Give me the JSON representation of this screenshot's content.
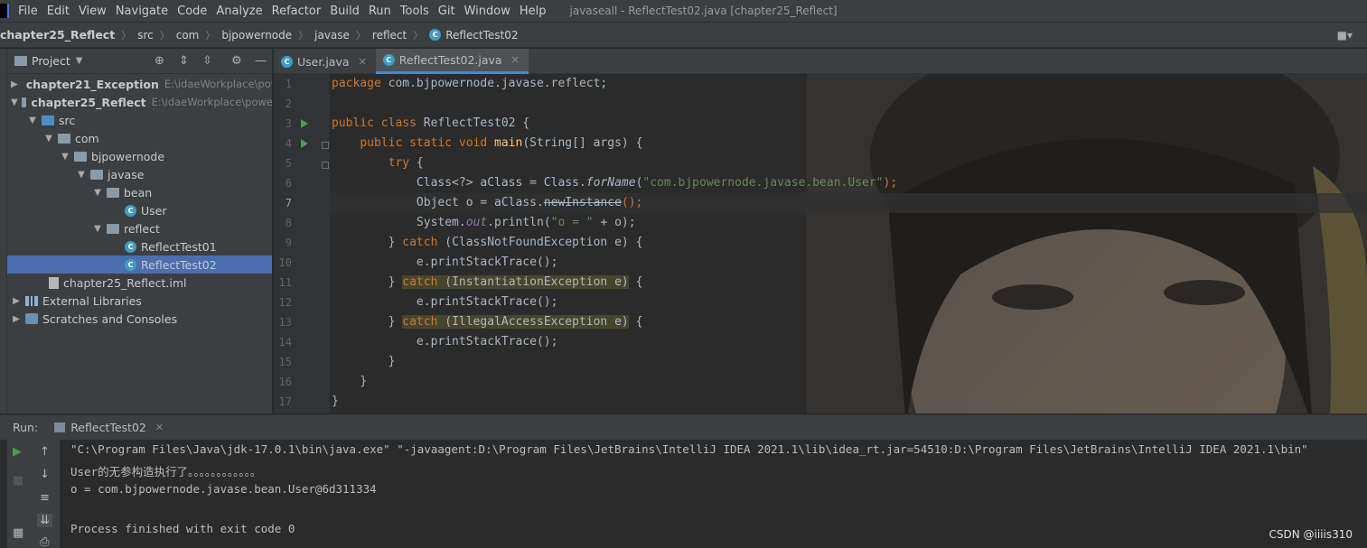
{
  "menubar": {
    "items": [
      "File",
      "Edit",
      "View",
      "Navigate",
      "Code",
      "Analyze",
      "Refactor",
      "Build",
      "Run",
      "Tools",
      "Git",
      "Window",
      "Help"
    ],
    "window_title": "javaseall - ReflectTest02.java [chapter25_Reflect]"
  },
  "breadcrumb": [
    "chapter25_Reflect",
    "src",
    "com",
    "bjpowernode",
    "javase",
    "reflect",
    "ReflectTest02"
  ],
  "project": {
    "title": "Project",
    "tree": [
      {
        "label": "chapter21_Exception",
        "path": "E:\\idaeWorkplace\\pow",
        "bold": true
      },
      {
        "label": "chapter25_Reflect",
        "path": "E:\\idaeWorkplace\\powe",
        "bold": true
      },
      {
        "label": "src"
      },
      {
        "label": "com"
      },
      {
        "label": "bjpowernode"
      },
      {
        "label": "javase"
      },
      {
        "label": "bean"
      },
      {
        "label": "User"
      },
      {
        "label": "reflect"
      },
      {
        "label": "ReflectTest01"
      },
      {
        "label": "ReflectTest02"
      },
      {
        "label": "chapter25_Reflect.iml"
      },
      {
        "label": "External Libraries"
      },
      {
        "label": "Scratches and Consoles"
      }
    ]
  },
  "editor": {
    "tabs": [
      "User.java",
      "ReflectTest02.java"
    ],
    "line_numbers": [
      "1",
      "2",
      "3",
      "4",
      "5",
      "6",
      "7",
      "8",
      "9",
      "10",
      "11",
      "12",
      "13",
      "14",
      "15",
      "16",
      "17"
    ],
    "code": {
      "l1_kw": "package",
      "l1_rest": " com.bjpowernode.javase.reflect;",
      "l3_kw": "public class",
      "l3_rest": " ReflectTest02 {",
      "l4_kw": "public static void",
      "l4_fn": "main",
      "l4_rest": "(String[] args) {",
      "l5_kw": "try",
      "l5_rest": " {",
      "l6_a": "Class<?> aClass = Class.",
      "l6_b": "forName",
      "l6_c": "(",
      "l6_str": "\"com.bjpowernode.javase.bean.User\"",
      "l6_d": ");",
      "l7_a": "Object o = aClass.",
      "l7_dep": "newInstance",
      "l7_b": "();",
      "l8_a": "System.",
      "l8_static": "out",
      "l8_b": ".println(",
      "l8_str": "\"o = \"",
      "l8_c": " + o);",
      "l9_a": "} ",
      "l9_kw": "catch",
      "l9_b": " (ClassNotFoundException e) {",
      "l10": "e.printStackTrace();",
      "l11_a": "} ",
      "l11_kw": "catch",
      "l11_b": " (InstantiationException e)",
      "l11_c": " {",
      "l12": "e.printStackTrace();",
      "l13_a": "} ",
      "l13_kw": "catch",
      "l13_b": " (IllegalAccessException e)",
      "l13_c": " {",
      "l14": "e.printStackTrace();",
      "l15": "}",
      "l16": "}",
      "l17": "}"
    }
  },
  "run": {
    "label": "Run:",
    "tab": "ReflectTest02",
    "output": [
      "\"C:\\Program Files\\Java\\jdk-17.0.1\\bin\\java.exe\" \"-javaagent:D:\\Program Files\\JetBrains\\IntelliJ IDEA 2021.1\\lib\\idea_rt.jar=54510:D:\\Program Files\\JetBrains\\IntelliJ IDEA 2021.1\\bin\"",
      "User的无参构造执行了。。。。。。。。。。。。",
      "o = com.bjpowernode.javase.bean.User@6d311334",
      "Process finished with exit code 0"
    ]
  },
  "watermark": "CSDN @iiiis310",
  "colors": {
    "keyword": "#cc7832",
    "string": "#6a8759",
    "function": "#ffc66d",
    "selection": "#4b6eaf"
  }
}
